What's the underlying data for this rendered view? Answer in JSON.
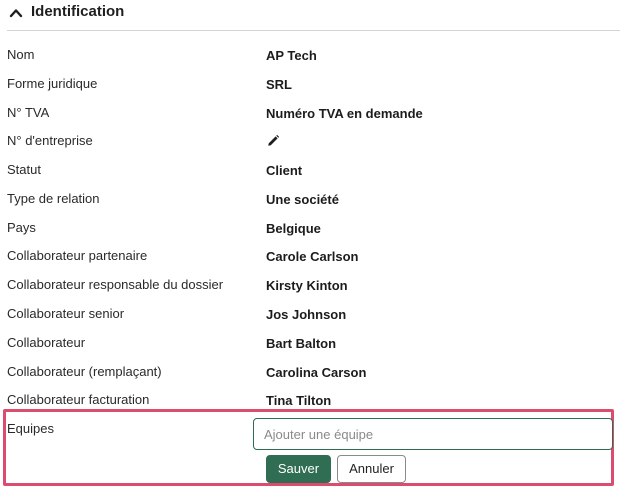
{
  "section": {
    "title": "Identification",
    "chevron_icon": "chevron-up-icon"
  },
  "fields": [
    {
      "label": "Nom",
      "value": "AP Tech"
    },
    {
      "label": "Forme juridique",
      "value": "SRL"
    },
    {
      "label": "N° TVA",
      "value": "Numéro TVA en demande"
    },
    {
      "label": "N° d'entreprise",
      "value": "",
      "icon": "pencil-icon"
    },
    {
      "label": "Statut",
      "value": "Client"
    },
    {
      "label": "Type de relation",
      "value": "Une société"
    },
    {
      "label": "Pays",
      "value": "Belgique"
    },
    {
      "label": "Collaborateur partenaire",
      "value": "Carole Carlson"
    },
    {
      "label": "Collaborateur responsable du dossier",
      "value": "Kirsty Kinton"
    },
    {
      "label": "Collaborateur senior",
      "value": "Jos Johnson"
    },
    {
      "label": "Collaborateur",
      "value": "Bart Balton"
    },
    {
      "label": "Collaborateur (remplaçant)",
      "value": "Carolina Carson"
    },
    {
      "label": "Collaborateur facturation",
      "value": "Tina Tilton"
    }
  ],
  "teams": {
    "label": "Equipes",
    "input_value": "",
    "input_placeholder": "Ajouter une équipe",
    "save_label": "Sauver",
    "cancel_label": "Annuler"
  },
  "colors": {
    "primary_green": "#2f6e52",
    "highlight_pink": "#dc4d6d"
  }
}
